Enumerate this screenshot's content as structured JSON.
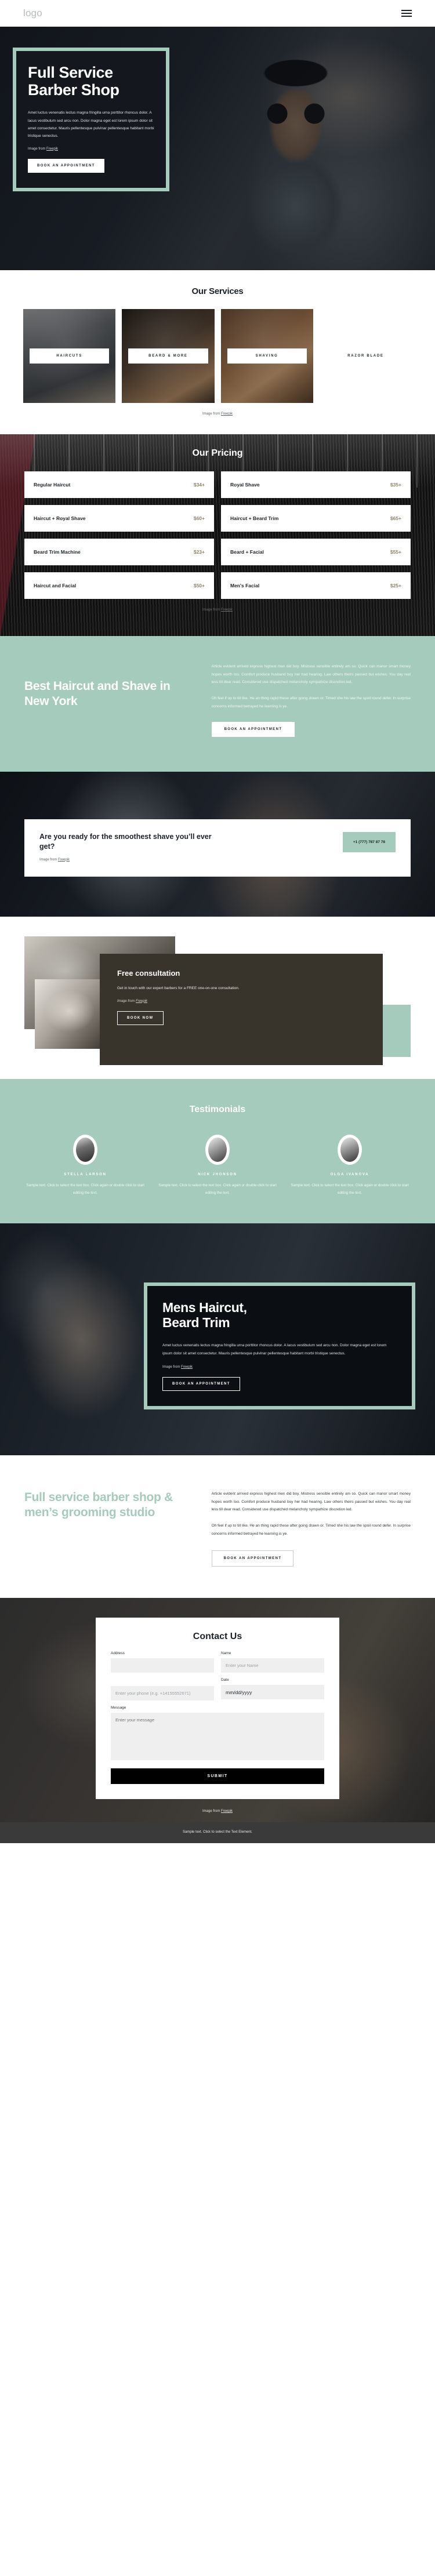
{
  "header": {
    "logo": "logo",
    "menu_icon": "hamburger-menu-icon"
  },
  "hero": {
    "title_line1": "Full Service",
    "title_line2": "Barber Shop",
    "body": "Amet luctus venenatis lectus magna fringilla urna porttitor rhoncus dolor. A lacus vestibulum sed arcu non. Dolor magna eget est lorem ipsum dolor sit amet consectetur. Mauris pellentesque pulvinar pellentesque habitant morbi tristique senectus.",
    "credit_prefix": "Image from ",
    "credit_link": "Freepik",
    "cta": "BOOK AN APPOINTMENT"
  },
  "services": {
    "title": "Our Services",
    "items": [
      {
        "label": "HAIRCUTS"
      },
      {
        "label": "BEARD & MORE"
      },
      {
        "label": "SHAVING"
      },
      {
        "label": "RAZOR BLADE"
      }
    ],
    "credit_prefix": "Image from ",
    "credit_link": "Freepik"
  },
  "pricing": {
    "title": "Our Pricing",
    "items": [
      {
        "name": "Regular Haircut",
        "price": "$34+"
      },
      {
        "name": "Royal Shave",
        "price": "$35+"
      },
      {
        "name": "Haircut + Royal Shave",
        "price": "$60+"
      },
      {
        "name": "Haircut + Beard Trim",
        "price": "$65+"
      },
      {
        "name": "Beard Trim Machine",
        "price": "$23+"
      },
      {
        "name": "Beard + Facial",
        "price": "$55+"
      },
      {
        "name": "Haircut and Facial",
        "price": "$50+"
      },
      {
        "name": "Men's Facial",
        "price": "$25+"
      }
    ],
    "credit_prefix": "Image from ",
    "credit_link": "Freepik"
  },
  "best": {
    "title": "Best Haircut and Shave in New York",
    "para1": "Article evident arrived express highest men did boy. Mistress sensible entirely am so. Quick can manor smart money hopes worth too. Comfort produce husband boy her had hearing. Law others theirs passed but wishes. You day real less till dear read. Considered use dispatched melancholy sympathize discretion led.",
    "para2": "Oh feel if up to till like. He an thing rapid these after going drawn or. Timed she his law the spoil round defer. In surprise concerns informed betrayed he learning is ye.",
    "cta": "BOOK AN APPOINTMENT"
  },
  "shave": {
    "title": "Are you ready for the smoothest shave you’ll ever get?",
    "credit_prefix": "Image from ",
    "credit_link": "Freepik",
    "phone": "+1 (777) 787 87 78"
  },
  "consult": {
    "title": "Free consultation",
    "body": "Get in touch with our expert barbers for a FREE one-on-one consultation.",
    "credit_prefix": "Image from ",
    "credit_link": "Freepik",
    "cta": "BOOK NOW"
  },
  "testimonials": {
    "title": "Testimonials",
    "items": [
      {
        "name": "STELLA LARSON",
        "text": "Sample text. Click to select the text box. Click again or double click to start editing the text."
      },
      {
        "name": "NICK JHONSON",
        "text": "Sample text. Click to select the text box. Click again or double click to start editing the text."
      },
      {
        "name": "OLGA IVANOVA",
        "text": "Sample text. Click to select the text box. Click again or double click to start editing the text."
      }
    ]
  },
  "mens": {
    "title_line1": "Mens Haircut,",
    "title_line2": "Beard Trim",
    "body": "Amet luctus venenatis lectus magna fringilla urna porttitor rhoncus dolor. A lacus vestibulum sed arcu non. Dolor magna eget est lorem ipsum dolor sit amet consectetur. Mauris pellentesque pulvinar pellentesque habitant morbi tristique senectus.",
    "credit_prefix": "Image from ",
    "credit_link": "Freepik",
    "cta": "BOOK AN APPOINTMENT"
  },
  "grooming": {
    "title": "Full service barber shop & men’s grooming studio",
    "para1": "Article evident arrived express highest men did boy. Mistress sensible entirely am so. Quick can manor smart money hopes worth too. Comfort produce husband boy her had hearing. Law others theirs passed but wishes. You day real less till dear read. Considered use dispatched melancholy sympathize discretion led.",
    "para2": "Oh feel if up to till like. He an thing rapid these after going drawn or. Timed she his law the spoil round defer. In surprise concerns informed betrayed he learning is ye.",
    "cta": "BOOK AN APPOINTMENT"
  },
  "contact": {
    "title": "Contact Us",
    "address_label": "Address",
    "address_value": "",
    "address_placeholder": "",
    "name_label": "Name",
    "name_placeholder": "Enter your Name",
    "phone_placeholder": "Enter your phone (e.g. +14155552671)",
    "date_label": "Date",
    "date_value": "mm/dd/yyyy",
    "message_label": "Message",
    "message_placeholder": "Enter your message",
    "submit": "SUBMIT",
    "credit_prefix": "Image from ",
    "credit_link": "Freepik"
  },
  "footer": {
    "text": "Sample text. Click to select the Text Element."
  }
}
